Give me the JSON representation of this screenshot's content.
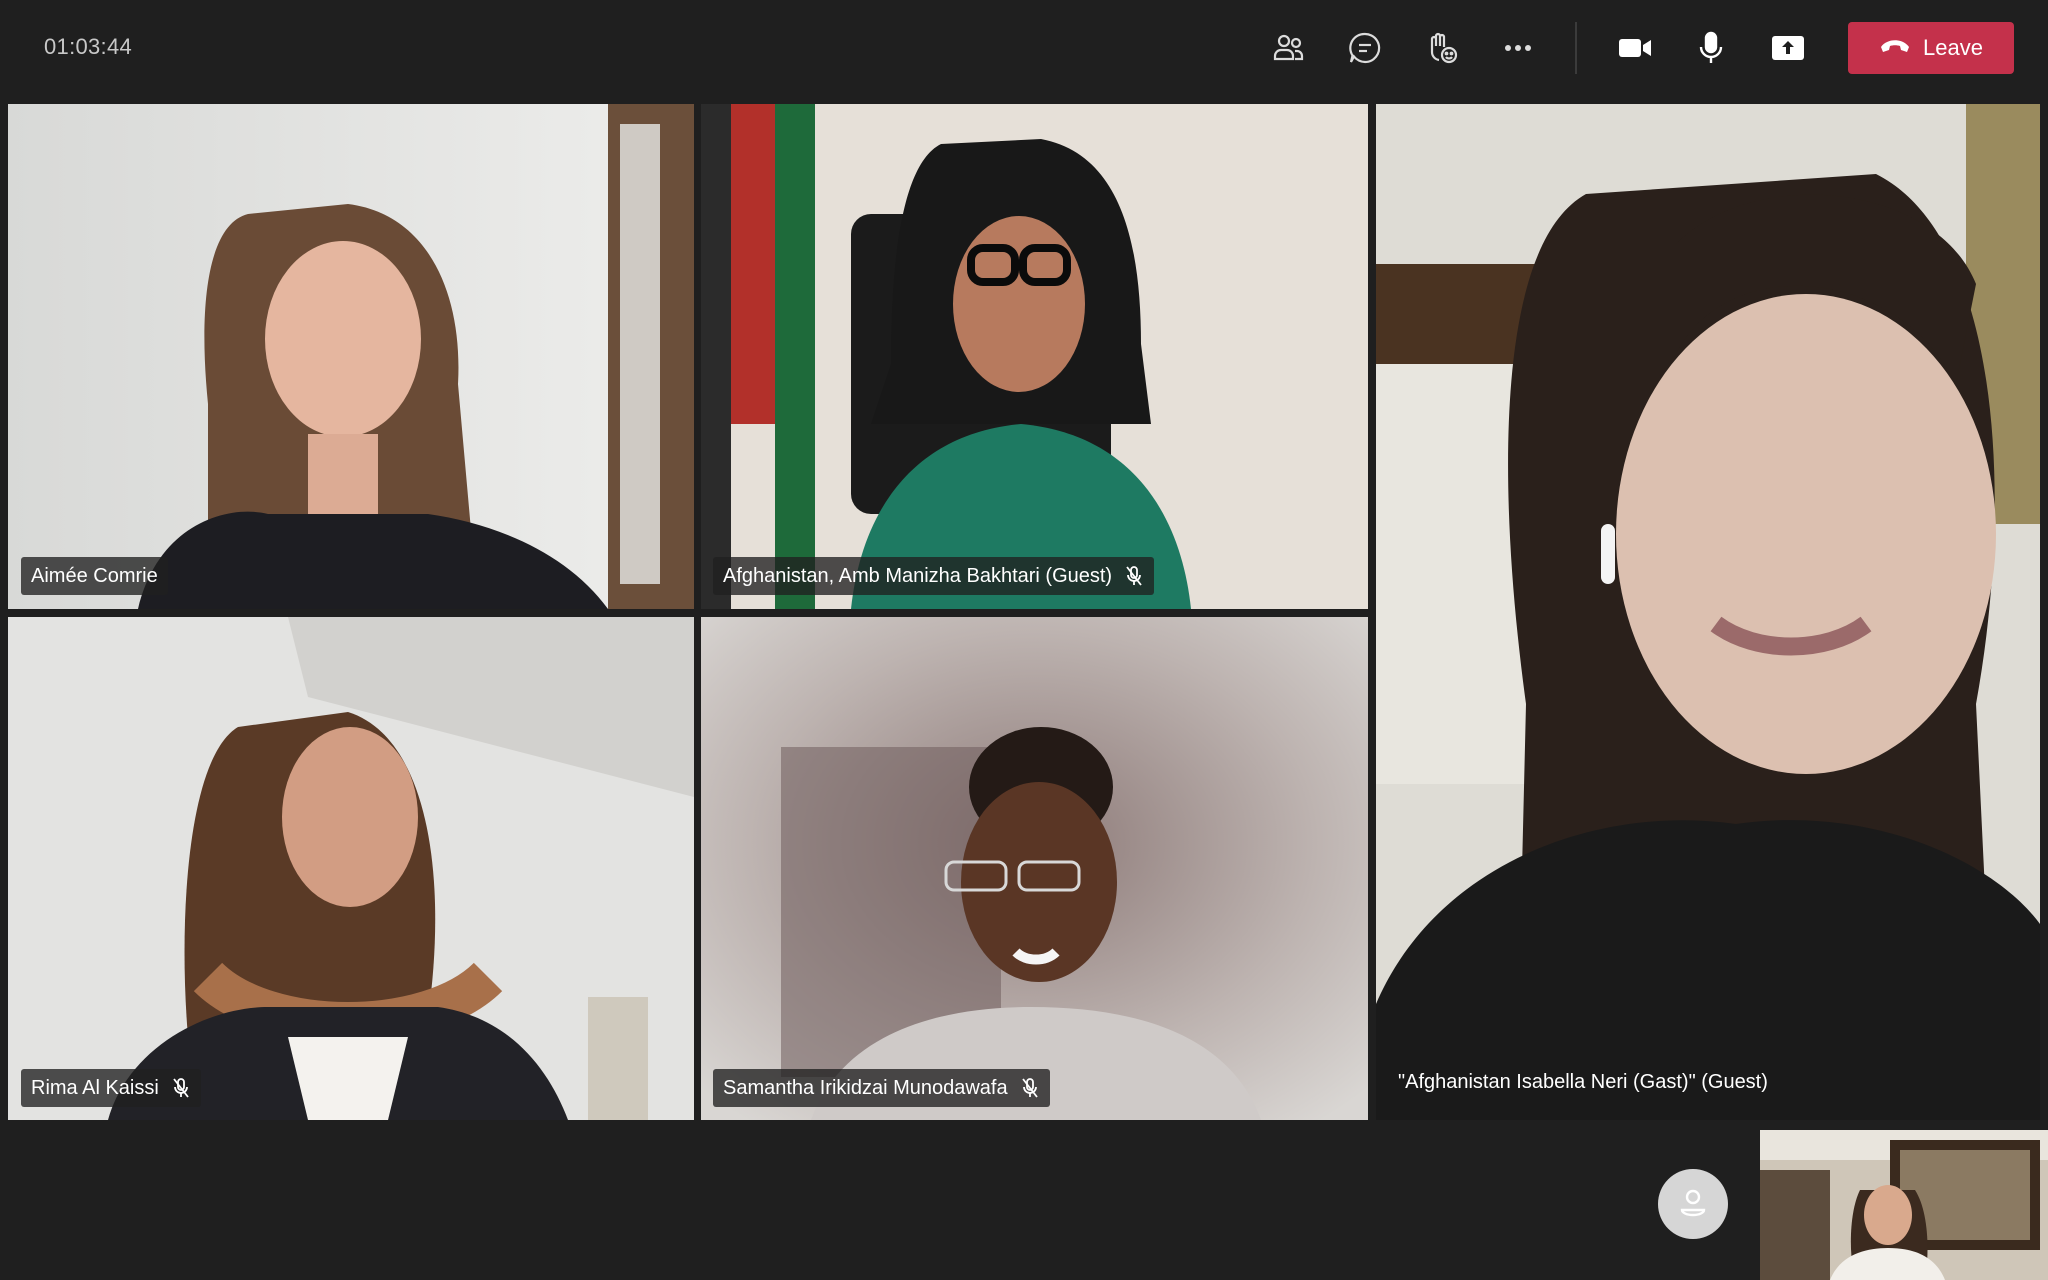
{
  "call": {
    "timer": "01:03:44",
    "leave_label": "Leave"
  },
  "toolbar": {
    "icons": [
      "people-icon",
      "chat-icon",
      "raise-hand-icon",
      "more-options-icon",
      "camera-icon",
      "microphone-icon",
      "share-screen-icon",
      "phone-hangup-icon"
    ]
  },
  "participants": [
    {
      "name": "Aimée Comrie",
      "muted": false
    },
    {
      "name": "Afghanistan, Amb Manizha Bakhtari (Guest)",
      "muted": true
    },
    {
      "name": "\"Afghanistan Isabella Neri (Gast)\" (Guest)",
      "muted": false
    },
    {
      "name": "Rima Al Kaissi",
      "muted": true
    },
    {
      "name": "Samantha Irikidzai Munodawafa",
      "muted": true
    }
  ],
  "colors": {
    "background": "#1f1f1f",
    "leave_button": "#c4314b",
    "nameplate": "#202020"
  }
}
